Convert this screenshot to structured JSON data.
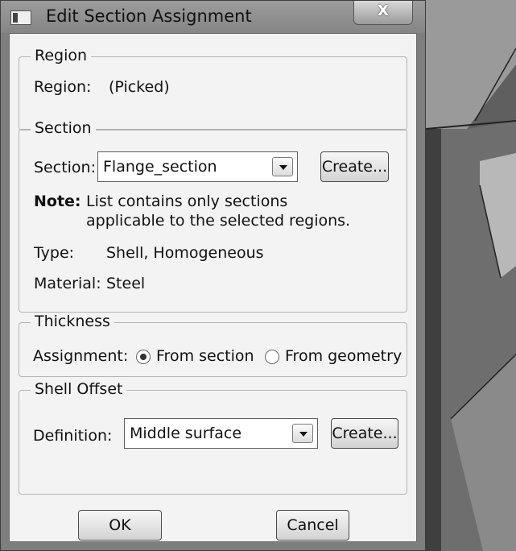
{
  "dialog": {
    "title": "Edit Section Assignment",
    "close_label": "X"
  },
  "region": {
    "group_title": "Region",
    "label": "Region:",
    "value": "(Picked)"
  },
  "section": {
    "group_title": "Section",
    "label": "Section:",
    "selected": "Flange_section",
    "create_label": "Create...",
    "note_label": "Note:",
    "note_line1": "List contains only sections",
    "note_line2": "applicable to the selected regions.",
    "type_label": "Type:",
    "type_value": "Shell, Homogeneous",
    "material_label": "Material:",
    "material_value": "Steel"
  },
  "thickness": {
    "group_title": "Thickness",
    "assignment_label": "Assignment:",
    "option_section": "From section",
    "option_geometry": "From geometry",
    "selected": "From section"
  },
  "shell_offset": {
    "group_title": "Shell Offset",
    "definition_label": "Definition:",
    "selected": "Middle surface",
    "create_label": "Create..."
  },
  "footer": {
    "ok_label": "OK",
    "cancel_label": "Cancel"
  },
  "colors": {
    "dialog_background": "#f3f3f3",
    "title_bar": "#8f8f8f",
    "viewport_background": "#6b6b6b"
  }
}
